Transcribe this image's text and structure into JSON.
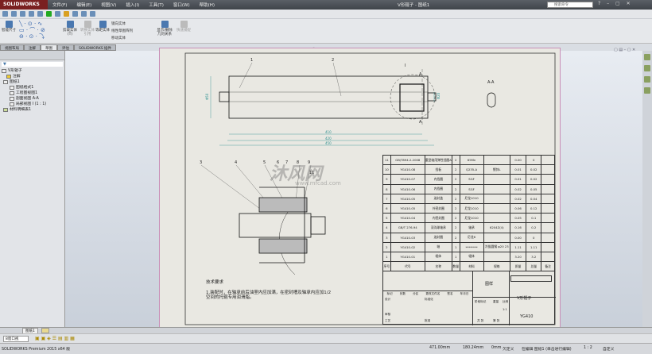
{
  "app": {
    "logo": "SOLIDWORKS",
    "title": "V形辊子 - 图纸1",
    "search_placeholder": "搜索命令",
    "menus": [
      "文件(F)",
      "编辑(E)",
      "视图(V)",
      "插入(I)",
      "工具(T)",
      "窗口(W)",
      "帮助(H)"
    ]
  },
  "ribbon": {
    "smart_dim": "智能尺寸",
    "trim": "剪裁实体(T)",
    "convert": "转换实体引用",
    "offset": "等距实体",
    "mirror": "镜向实体",
    "linear_pattern": "线性草图阵列",
    "move": "移动实体",
    "display_relations": "显示/删除几何关系",
    "repair": "快速捕捉"
  },
  "tabs": [
    "视图布局",
    "注解",
    "草图",
    "评估",
    "SOLIDWORKS 插件"
  ],
  "active_tab": "草图",
  "tree": {
    "root": "V形辊子",
    "items": [
      "注解",
      "图纸1",
      "图纸格式1",
      "工程图视图1",
      "剖面视图 A-A",
      "局部视图 I (1 : 1)",
      "材料明细表1"
    ]
  },
  "drawing": {
    "balloons": [
      "1",
      "2",
      "3",
      "4",
      "5",
      "6",
      "7",
      "8",
      "9",
      "11"
    ],
    "dims": [
      "410",
      "420",
      "450",
      "Φ50",
      "Φ20"
    ],
    "section_label": "A",
    "section_view": "A-A",
    "detail_label": "I",
    "watermark": "沐风网",
    "watermark_url": "www.mfcad.com",
    "tech_title": "技术要求",
    "tech_text": "1.装配时，在轴承前后油室内应加满，在密封槽及轴承内应加1/2\n空间的托辊专用润滑脂。",
    "bom_rows": [
      [
        "11",
        "GB/T894.2-2008",
        "重型轴用弹性挡圈A",
        "2",
        "65Mn",
        "",
        "0.00",
        "0",
        ""
      ],
      [
        "10",
        "YG410-08",
        "挡板",
        "2",
        "Q235-A",
        "镀锌L",
        "0.01",
        "0.02",
        ""
      ],
      [
        "9",
        "YG410-07",
        "内挡圈",
        "2",
        "SGF",
        "",
        "0.01",
        "0.02",
        ""
      ],
      [
        "8",
        "YG410-06",
        "内挡圈",
        "2",
        "SGF",
        "",
        "0.02",
        "0.05",
        ""
      ],
      [
        "7",
        "YG410-05",
        "迷封盖",
        "2",
        "尼龙1010",
        "",
        "0.02",
        "0.04",
        ""
      ],
      [
        "6",
        "YG410-05",
        "外密封圈",
        "2",
        "尼龙1010",
        "",
        "0.06",
        "0.12",
        ""
      ],
      [
        "5",
        "YG410-04",
        "内密封圈",
        "2",
        "尼龙1010",
        "",
        "0.05",
        "0.1",
        ""
      ],
      [
        "4",
        "GB/T 276-94",
        "深沟球轴承",
        "2",
        "轴承",
        "6204Z(4)",
        "0.16",
        "0.2",
        ""
      ],
      [
        "3",
        "YG410-03",
        "迷封圈",
        "2",
        "尼龙6",
        "",
        "0.00",
        "0",
        ""
      ],
      [
        "2",
        "YG410-02",
        "轴",
        "1",
        "********",
        "冷拔圆钢 φ20 23",
        "1.11",
        "1.11",
        ""
      ],
      [
        "1",
        "YG410-01",
        "辊体",
        "1",
        "辊体",
        "",
        "3.20",
        "3.2",
        ""
      ]
    ],
    "bom_header": [
      "序号",
      "代号",
      "名称",
      "数量",
      "材料",
      "规格",
      "质量",
      "总量",
      "备注"
    ],
    "title_block": {
      "labels": [
        "标记",
        "处数",
        "分区",
        "更改文件名",
        "签名",
        "年月日",
        "设计",
        "标准化",
        "审核",
        "工艺",
        "批准",
        "阶段标记",
        "重量",
        "比例",
        "共 张",
        "第 张"
      ],
      "material": "图样",
      "scale": "1:1",
      "part_name": "V形辊子",
      "drawing_no": "YG410"
    }
  },
  "sheet_tab": "图纸1",
  "bottom": {
    "view_select": "8窗口视"
  },
  "status": {
    "product": "SOLIDWORKS Premium 2015 x64 版",
    "x": "471.00mm",
    "y": "180.24mm",
    "z": "0mm",
    "state": "欠定义",
    "editing": "在编辑 图纸1 (单击进行编辑)",
    "scale": "1 : 2",
    "unit": "自定义"
  }
}
